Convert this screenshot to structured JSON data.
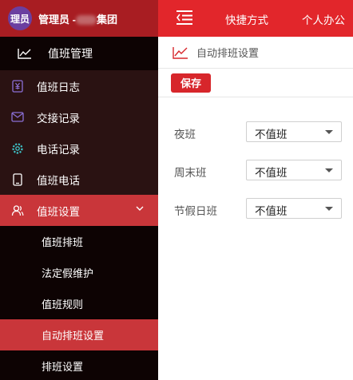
{
  "header": {
    "avatar_text": "理员",
    "user_label": "管理员 -",
    "org_name": "集团"
  },
  "module": {
    "label": "值班管理",
    "icon": "line-chart-icon"
  },
  "nav": {
    "items": [
      {
        "label": "值班日志",
        "icon": "yen-icon"
      },
      {
        "label": "交接记录",
        "icon": "mail-icon"
      },
      {
        "label": "电话记录",
        "icon": "gear-icon"
      },
      {
        "label": "值班电话",
        "icon": "phone-icon"
      },
      {
        "label": "值班设置",
        "icon": "users-icon"
      }
    ],
    "sub_items": [
      {
        "label": "值班排班"
      },
      {
        "label": "法定假维护"
      },
      {
        "label": "值班规则"
      },
      {
        "label": "自动排班设置"
      },
      {
        "label": "排班设置"
      }
    ]
  },
  "topbar": {
    "link1": "快捷方式",
    "link2": "个人办公"
  },
  "breadcrumb": {
    "title": "自动排班设置",
    "icon": "line-chart-icon"
  },
  "toolbar": {
    "save_label": "保存"
  },
  "form": {
    "rows": [
      {
        "label": "夜班",
        "value": "不值班"
      },
      {
        "label": "周末班",
        "value": "不值班"
      },
      {
        "label": "节假日班",
        "value": "不值班"
      }
    ]
  },
  "colors": {
    "accent": "#e2262b",
    "active": "#c9363a",
    "sidebar": "#1f0c0c",
    "icon_purple": "#8b6fd6",
    "icon_teal": "#3ec3c8"
  }
}
